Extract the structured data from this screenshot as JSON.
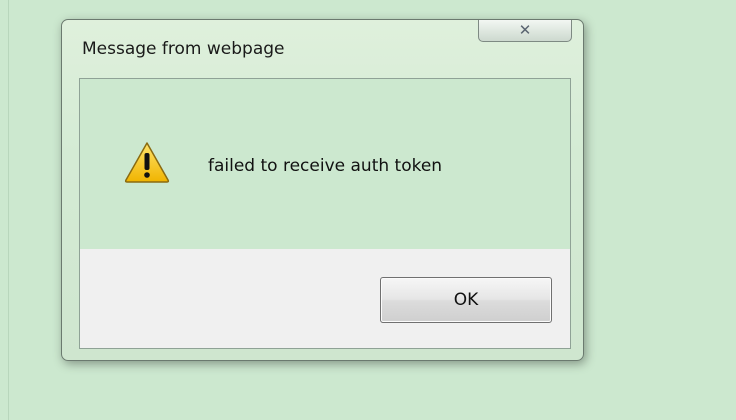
{
  "dialog": {
    "title": "Message from webpage",
    "close_icon": "close-icon",
    "warning_icon": "warning-icon",
    "message": "failed to receive auth token",
    "ok_label": "OK"
  }
}
